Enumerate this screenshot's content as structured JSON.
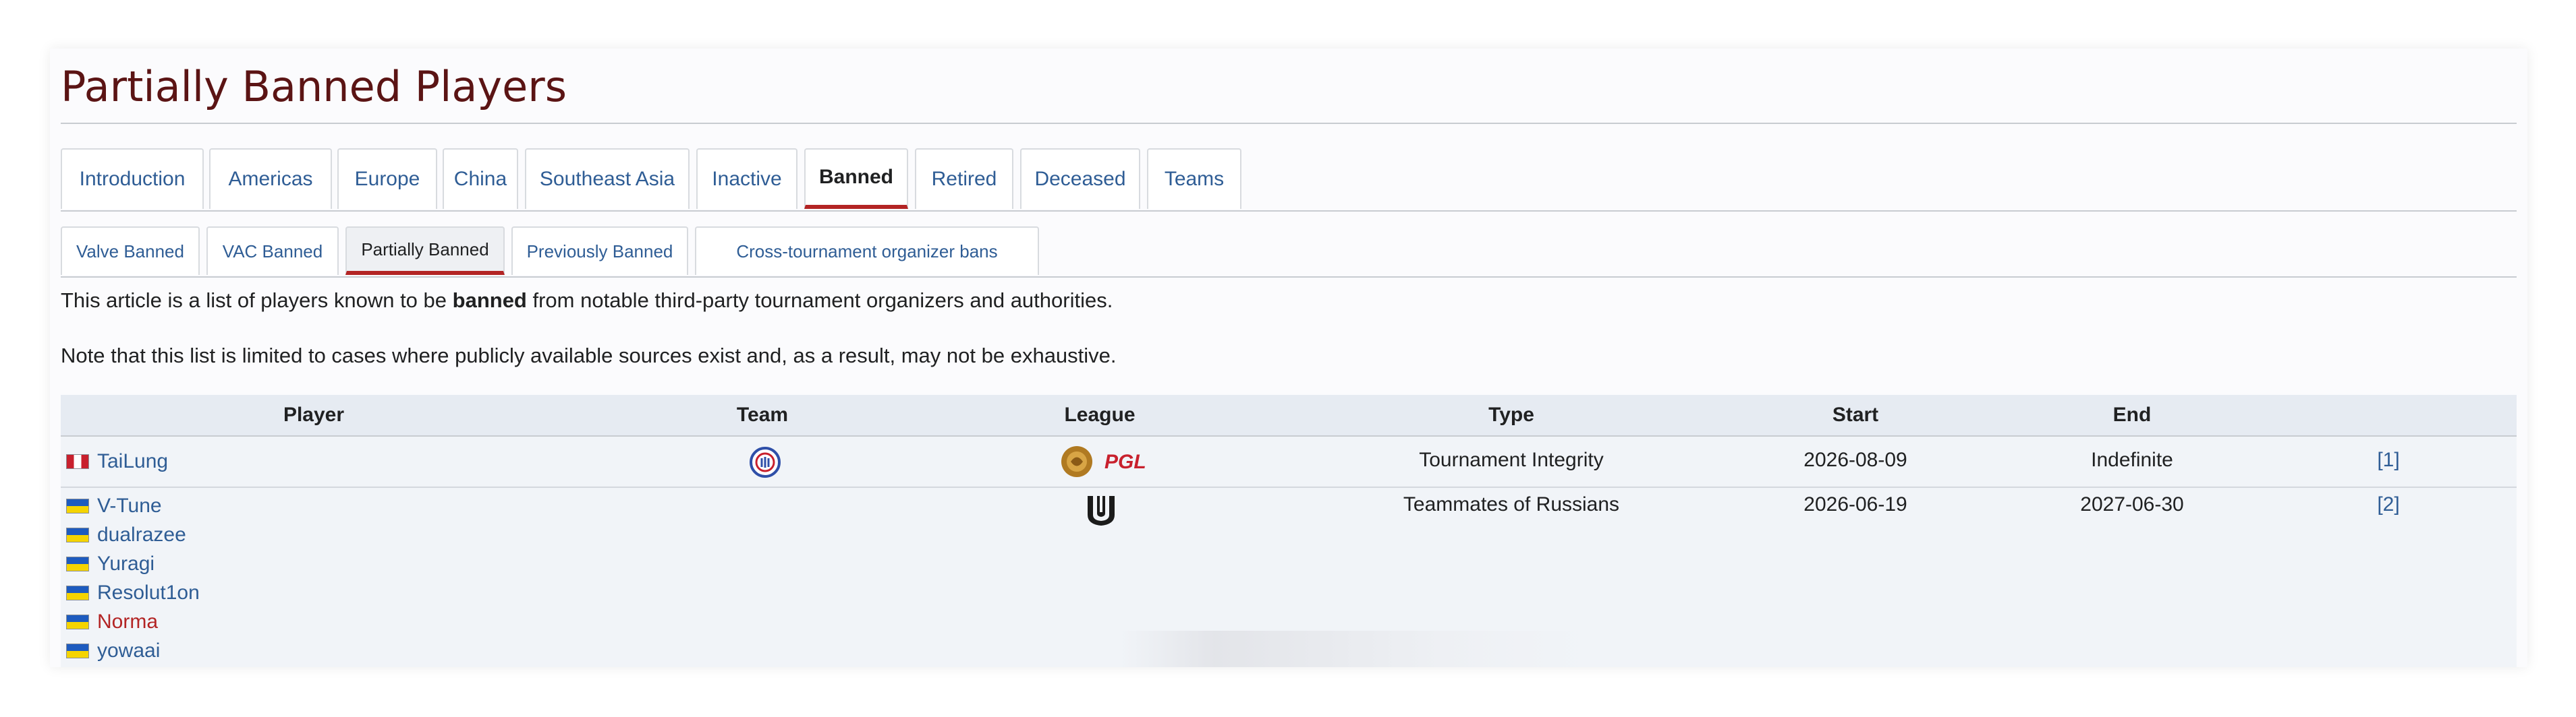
{
  "page": {
    "title": "Partially Banned Players"
  },
  "main_tabs": [
    {
      "label": "Introduction",
      "active": false
    },
    {
      "label": "Americas",
      "active": false
    },
    {
      "label": "Europe",
      "active": false
    },
    {
      "label": "China",
      "active": false
    },
    {
      "label": "Southeast Asia",
      "active": false
    },
    {
      "label": "Inactive",
      "active": false
    },
    {
      "label": "Banned",
      "active": true
    },
    {
      "label": "Retired",
      "active": false
    },
    {
      "label": "Deceased",
      "active": false
    },
    {
      "label": "Teams",
      "active": false
    }
  ],
  "sub_tabs": [
    {
      "label": "Valve Banned",
      "active": false
    },
    {
      "label": "VAC Banned",
      "active": false
    },
    {
      "label": "Partially Banned",
      "active": true
    },
    {
      "label": "Previously Banned",
      "active": false
    },
    {
      "label": "Cross-tournament organizer bans",
      "active": false
    }
  ],
  "intro": {
    "part1": "This article is a list of players known to be ",
    "bold": "banned",
    "part2": " from notable third-party tournament organizers and authorities."
  },
  "note": "Note that this list is limited to cases where publicly available sources exist and, as a result, may not be exhaustive.",
  "table": {
    "headers": [
      "Player",
      "Team",
      "League",
      "Type",
      "Start",
      "End",
      ""
    ],
    "rows": [
      {
        "players": [
          {
            "name": "TaiLung",
            "flag": "peru-flag-icon",
            "style": "link"
          }
        ],
        "team_icon": "team-logo-icon",
        "league_icon": "pgl-logo-icon",
        "league_text": "PGL",
        "type": "Tournament Integrity",
        "start": "2026-08-09",
        "end": "Indefinite",
        "ref": "[1]"
      },
      {
        "players": [
          {
            "name": "V-Tune",
            "flag": "ukraine-flag-icon",
            "style": "link"
          },
          {
            "name": "dualrazee",
            "flag": "ukraine-flag-icon",
            "style": "link"
          },
          {
            "name": "Yuragi",
            "flag": "ukraine-flag-icon",
            "style": "link"
          },
          {
            "name": "Resolut1on",
            "flag": "ukraine-flag-icon",
            "style": "link"
          },
          {
            "name": "Norma",
            "flag": "ukraine-flag-icon",
            "style": "missing"
          },
          {
            "name": "yowaai",
            "flag": "ukraine-flag-icon",
            "style": "link"
          }
        ],
        "team_icon": "",
        "league_icon": "league-emblem-icon",
        "type": "Teammates of Russians",
        "start": "2026-06-19",
        "end": "2027-06-30",
        "ref": "[2]"
      }
    ]
  },
  "colors": {
    "title": "#5b1414",
    "link": "#2f5d95",
    "missing_link": "#b32424",
    "active_tab_underline": "#b32424"
  }
}
